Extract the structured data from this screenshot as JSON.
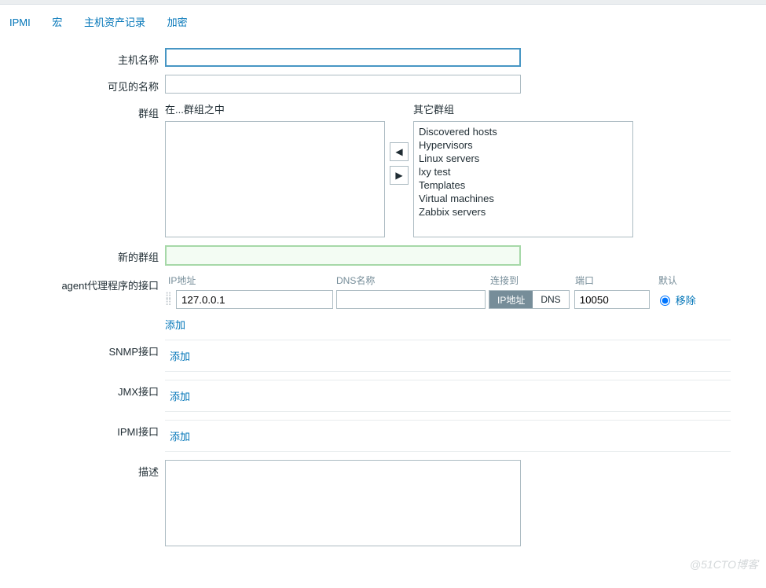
{
  "tabs": {
    "ipmi": "IPMI",
    "macros": "宏",
    "inventory": "主机资产记录",
    "encryption": "加密"
  },
  "labels": {
    "hostName": "主机名称",
    "visibleName": "可见的名称",
    "groups": "群组",
    "inGroups": "在...群组之中",
    "otherGroups": "其它群组",
    "newGroup": "新的群组",
    "agentIf": "agent代理程序的接口",
    "snmpIf": "SNMP接口",
    "jmxIf": "JMX接口",
    "ipmiIf": "IPMI接口",
    "description": "描述",
    "ipHeader": "IP地址",
    "dnsHeader": "DNS名称",
    "connHeader": "连接到",
    "portHeader": "端口",
    "defaultHeader": "默认",
    "segIP": "IP地址",
    "segDNS": "DNS",
    "addLink": "添加",
    "removeLink": "移除"
  },
  "values": {
    "hostName": "",
    "visibleName": "",
    "newGroup": "",
    "agentIP": "127.0.0.1",
    "agentDNS": "",
    "agentPort": "10050",
    "description": ""
  },
  "otherGroups": [
    "Discovered hosts",
    "Hypervisors",
    "Linux servers",
    "lxy test",
    "Templates",
    "Virtual machines",
    "Zabbix servers"
  ],
  "watermark": "@51CTO博客"
}
